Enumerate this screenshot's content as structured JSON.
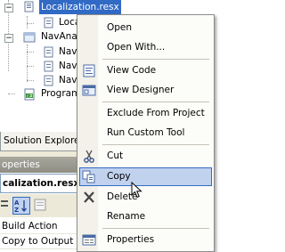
{
  "tree": {
    "nodes": [
      {
        "label": "Localization.resx",
        "selected": true
      },
      {
        "label": "Locali"
      },
      {
        "label": "NavAna"
      },
      {
        "label": "Nav"
      },
      {
        "label": "Nav"
      },
      {
        "label": "Nav"
      },
      {
        "label": "Program"
      }
    ]
  },
  "solution_explorer_tab": "Solution Explorer",
  "properties": {
    "title": "operties",
    "object": "calization.resx",
    "rows": [
      "Build Action",
      "Copy to Output Dir"
    ]
  },
  "context_menu": {
    "items": [
      {
        "label": "Open"
      },
      {
        "label": "Open With..."
      },
      {
        "label": "View Code",
        "icon": "view-code-icon"
      },
      {
        "label": "View Designer",
        "icon": "view-designer-icon"
      },
      {
        "label": "Exclude From Project"
      },
      {
        "label": "Run Custom Tool"
      },
      {
        "label": "Cut",
        "icon": "scissors-icon"
      },
      {
        "label": "Copy",
        "icon": "copy-icon",
        "highlighted": true
      },
      {
        "label": "Delete",
        "icon": "delete-icon"
      },
      {
        "label": "Rename"
      },
      {
        "label": "Properties",
        "icon": "properties-icon"
      }
    ]
  },
  "colors": {
    "selection": "#316ac5",
    "menu_highlight": "#c1d2ee",
    "menu_gutter": "#f3f1ea"
  }
}
